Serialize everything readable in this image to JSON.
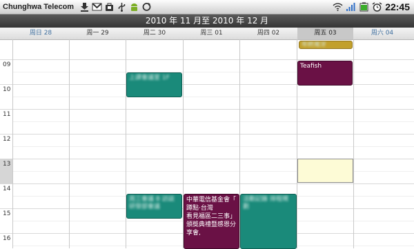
{
  "statusbar": {
    "carrier": "Chunghwa Telecom",
    "notifications": [
      "download-icon",
      "gmail-icon",
      "bag-icon",
      "usb-icon",
      "android-icon",
      "sync-icon"
    ],
    "system_icons": [
      "wifi-icon",
      "signal-icon",
      "battery-icon",
      "alarm-icon"
    ],
    "clock": "22:45"
  },
  "title": "2010 年 11 月至 2010 年 12 月",
  "days": [
    {
      "label": "周日 28",
      "type": "sun"
    },
    {
      "label": "周一 29",
      "type": "weekday"
    },
    {
      "label": "周二 30",
      "type": "weekday"
    },
    {
      "label": "周三 01",
      "type": "weekday"
    },
    {
      "label": "周四 02",
      "type": "weekday"
    },
    {
      "label": "周五 03",
      "type": "today"
    },
    {
      "label": "周六 04",
      "type": "sat"
    }
  ],
  "hours": [
    "09",
    "10",
    "11",
    "12",
    "13",
    "14",
    "15",
    "16"
  ],
  "events": {
    "allday_fri": {
      "text": "年終尾牙"
    },
    "teafish": {
      "text": "Teafish"
    },
    "tue_10": {
      "text": "上課會議室 1F"
    },
    "tue_15": {
      "text": "周三會議 B 訪談 研發部會議"
    },
    "wed_15": {
      "text": "中華電信基金會「\n蹲點‧台灣\n看見福區二三事」\n頒獎典禮暨感恩分\n享會,"
    },
    "thu_15": {
      "text": "活動記錄 排程規劃"
    }
  },
  "colors": {
    "teal": "#1a8a7a",
    "maroon": "#6a1145",
    "gold": "#c2a02c",
    "selected": "#fdfbd6"
  }
}
